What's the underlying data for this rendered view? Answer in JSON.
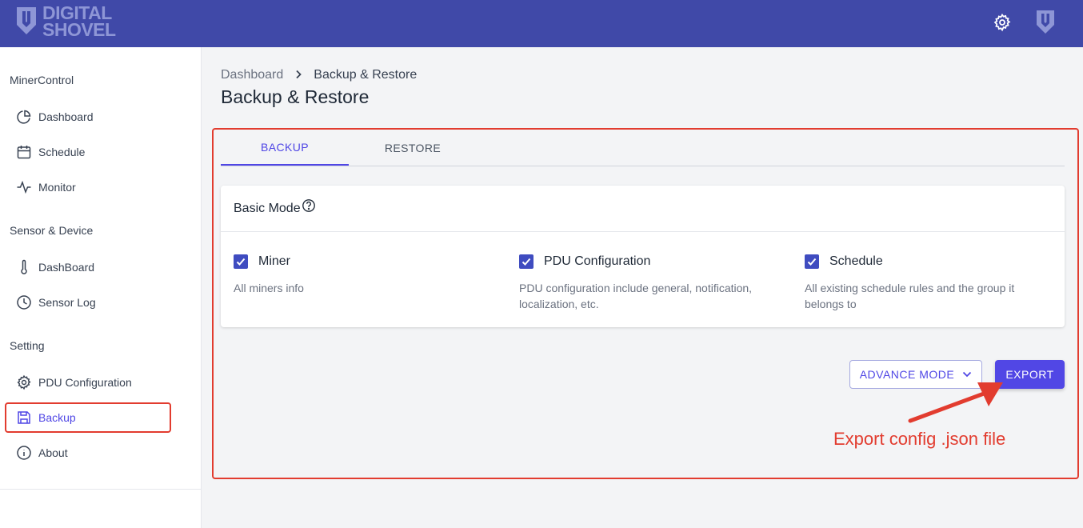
{
  "brand": {
    "line1": "DIGITAL",
    "line2": "SHOVEL"
  },
  "topbar": {
    "settings_icon": "gear-icon",
    "account_icon": "shield-logo-icon"
  },
  "sidebar": {
    "sections": [
      {
        "title": "MinerControl",
        "items": [
          {
            "label": "Dashboard",
            "icon": "pie-chart-icon"
          },
          {
            "label": "Schedule",
            "icon": "calendar-icon"
          },
          {
            "label": "Monitor",
            "icon": "activity-icon"
          }
        ]
      },
      {
        "title": "Sensor & Device",
        "items": [
          {
            "label": "DashBoard",
            "icon": "thermometer-icon"
          },
          {
            "label": "Sensor Log",
            "icon": "clock-icon"
          }
        ]
      },
      {
        "title": "Setting",
        "items": [
          {
            "label": "PDU Configuration",
            "icon": "gear-icon"
          },
          {
            "label": "Backup",
            "icon": "save-icon",
            "active": true
          },
          {
            "label": "About",
            "icon": "info-icon"
          }
        ]
      }
    ]
  },
  "breadcrumb": {
    "parent": "Dashboard",
    "separator": ">",
    "current": "Backup & Restore"
  },
  "page_title": "Backup & Restore",
  "tabs": [
    {
      "label": "BACKUP",
      "active": true
    },
    {
      "label": "RESTORE",
      "active": false
    }
  ],
  "card": {
    "title": "Basic Mode",
    "options": [
      {
        "name": "Miner",
        "checked": true,
        "description": "All miners info"
      },
      {
        "name": "PDU Configuration",
        "checked": true,
        "description": "PDU configuration include general, notification, localization, etc."
      },
      {
        "name": "Schedule",
        "checked": true,
        "description": "All existing schedule rules and the group it belongs to"
      }
    ]
  },
  "actions": {
    "advance_mode": "ADVANCE MODE",
    "export": "EXPORT"
  },
  "annotation": {
    "text": "Export config .json file"
  },
  "colors": {
    "topbar": "#4049a8",
    "accent": "#5147e5",
    "annotation": "#e23c2f"
  }
}
